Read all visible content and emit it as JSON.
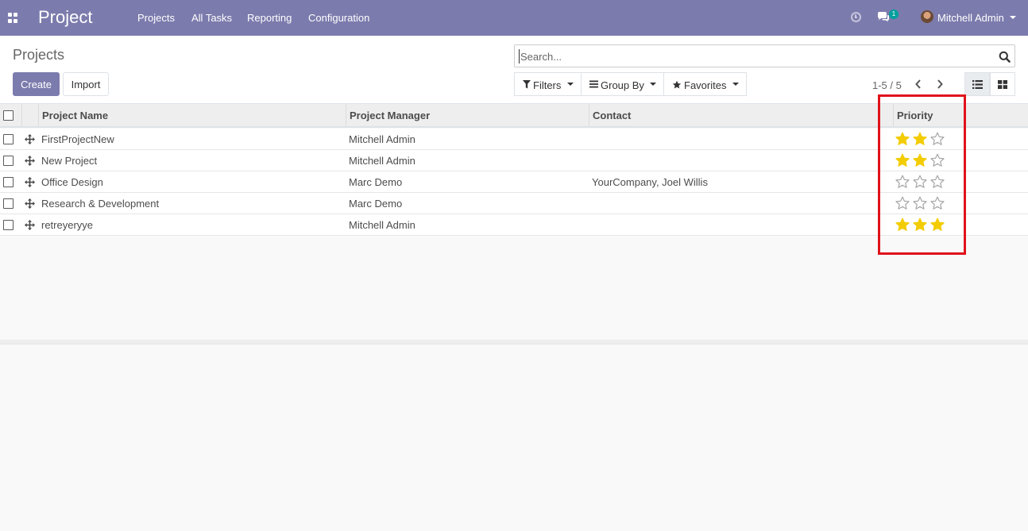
{
  "navbar": {
    "brand": "Project",
    "menu": [
      "Projects",
      "All Tasks",
      "Reporting",
      "Configuration"
    ],
    "chat_count": "1",
    "user_name": "Mitchell Admin"
  },
  "control_panel": {
    "title": "Projects",
    "create_label": "Create",
    "import_label": "Import",
    "search_placeholder": "Search...",
    "filters_label": "Filters",
    "group_by_label": "Group By",
    "favorites_label": "Favorites",
    "pager_text": "1-5 / 5"
  },
  "table": {
    "columns": [
      "Project Name",
      "Project Manager",
      "Contact",
      "Priority"
    ],
    "rows": [
      {
        "name": "FirstProjectNew",
        "manager": "Mitchell Admin",
        "contact": "",
        "priority": 2
      },
      {
        "name": "New Project",
        "manager": "Mitchell Admin",
        "contact": "",
        "priority": 2
      },
      {
        "name": "Office Design",
        "manager": "Marc Demo",
        "contact": "YourCompany, Joel Willis",
        "priority": 0
      },
      {
        "name": "Research & Development",
        "manager": "Marc Demo",
        "contact": "",
        "priority": 0
      },
      {
        "name": "retreyeryye",
        "manager": "Mitchell Admin",
        "contact": "",
        "priority": 3
      }
    ],
    "priority_max": 3
  },
  "colors": {
    "navbar": "#7c7bad",
    "primary": "#7c7bad",
    "star_filled": "#f3cc00",
    "star_empty": "#a8a8a8",
    "highlight": "#e0121b"
  },
  "icons": {
    "apps": "apps-grid-icon",
    "clock": "clock-icon",
    "chat": "chat-icon",
    "search": "search-icon",
    "filter": "filter-icon",
    "group": "bars-icon",
    "favorite": "star-icon",
    "prev": "chevron-left-icon",
    "next": "chevron-right-icon",
    "list_view": "list-view-icon",
    "kanban_view": "kanban-view-icon",
    "drag": "drag-handle-icon"
  }
}
